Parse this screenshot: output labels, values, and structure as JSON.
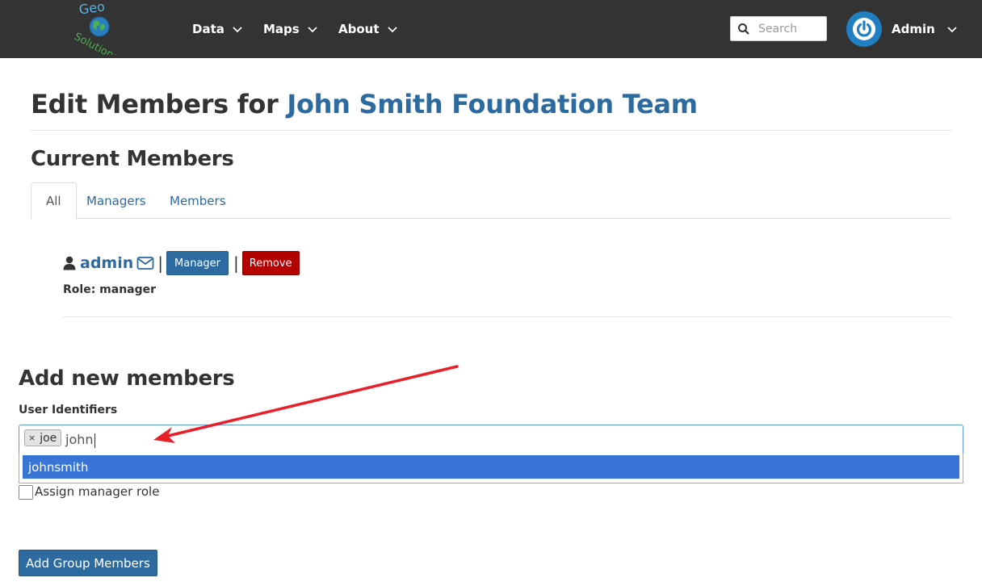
{
  "navbar": {
    "logo": {
      "top_text": "Geo",
      "bottom_text": "Solutions",
      "icon": "globe-icon"
    },
    "items": [
      {
        "label": "Data"
      },
      {
        "label": "Maps"
      },
      {
        "label": "About"
      }
    ],
    "search": {
      "placeholder": "Search",
      "icon": "search-icon"
    },
    "user": {
      "name": "Admin",
      "avatar_icon": "power-icon"
    },
    "colors": {
      "bar": "#333333",
      "avatar": "#1f7fc1"
    }
  },
  "page": {
    "title_prefix": "Edit Members for ",
    "team_name": "John Smith Foundation Team",
    "current_members_heading": "Current Members"
  },
  "tabs": [
    {
      "label": "All",
      "active": true
    },
    {
      "label": "Managers",
      "active": false
    },
    {
      "label": "Members",
      "active": false
    }
  ],
  "members": [
    {
      "username": "admin",
      "user_icon": "user-icon",
      "mail_icon": "envelope-icon",
      "separator": "|",
      "manager_button": "Manager",
      "remove_button": "Remove",
      "role_text": "Role: manager"
    }
  ],
  "add_members": {
    "heading": "Add new members",
    "field_label": "User Identifiers",
    "selected_chips": [
      {
        "label": "joe",
        "remove_symbol": "×"
      }
    ],
    "typed_text": "john",
    "suggestions": [
      {
        "label": "johnsmith",
        "highlighted": true
      }
    ],
    "assign_manager_label": "Assign manager role",
    "assign_manager_checked": false,
    "submit_button": "Add Group Members"
  },
  "colors": {
    "link": "#2c6aa0",
    "remove": "#b30000",
    "highlight": "#3875d7",
    "annotation_arrow": "#e8202a"
  }
}
